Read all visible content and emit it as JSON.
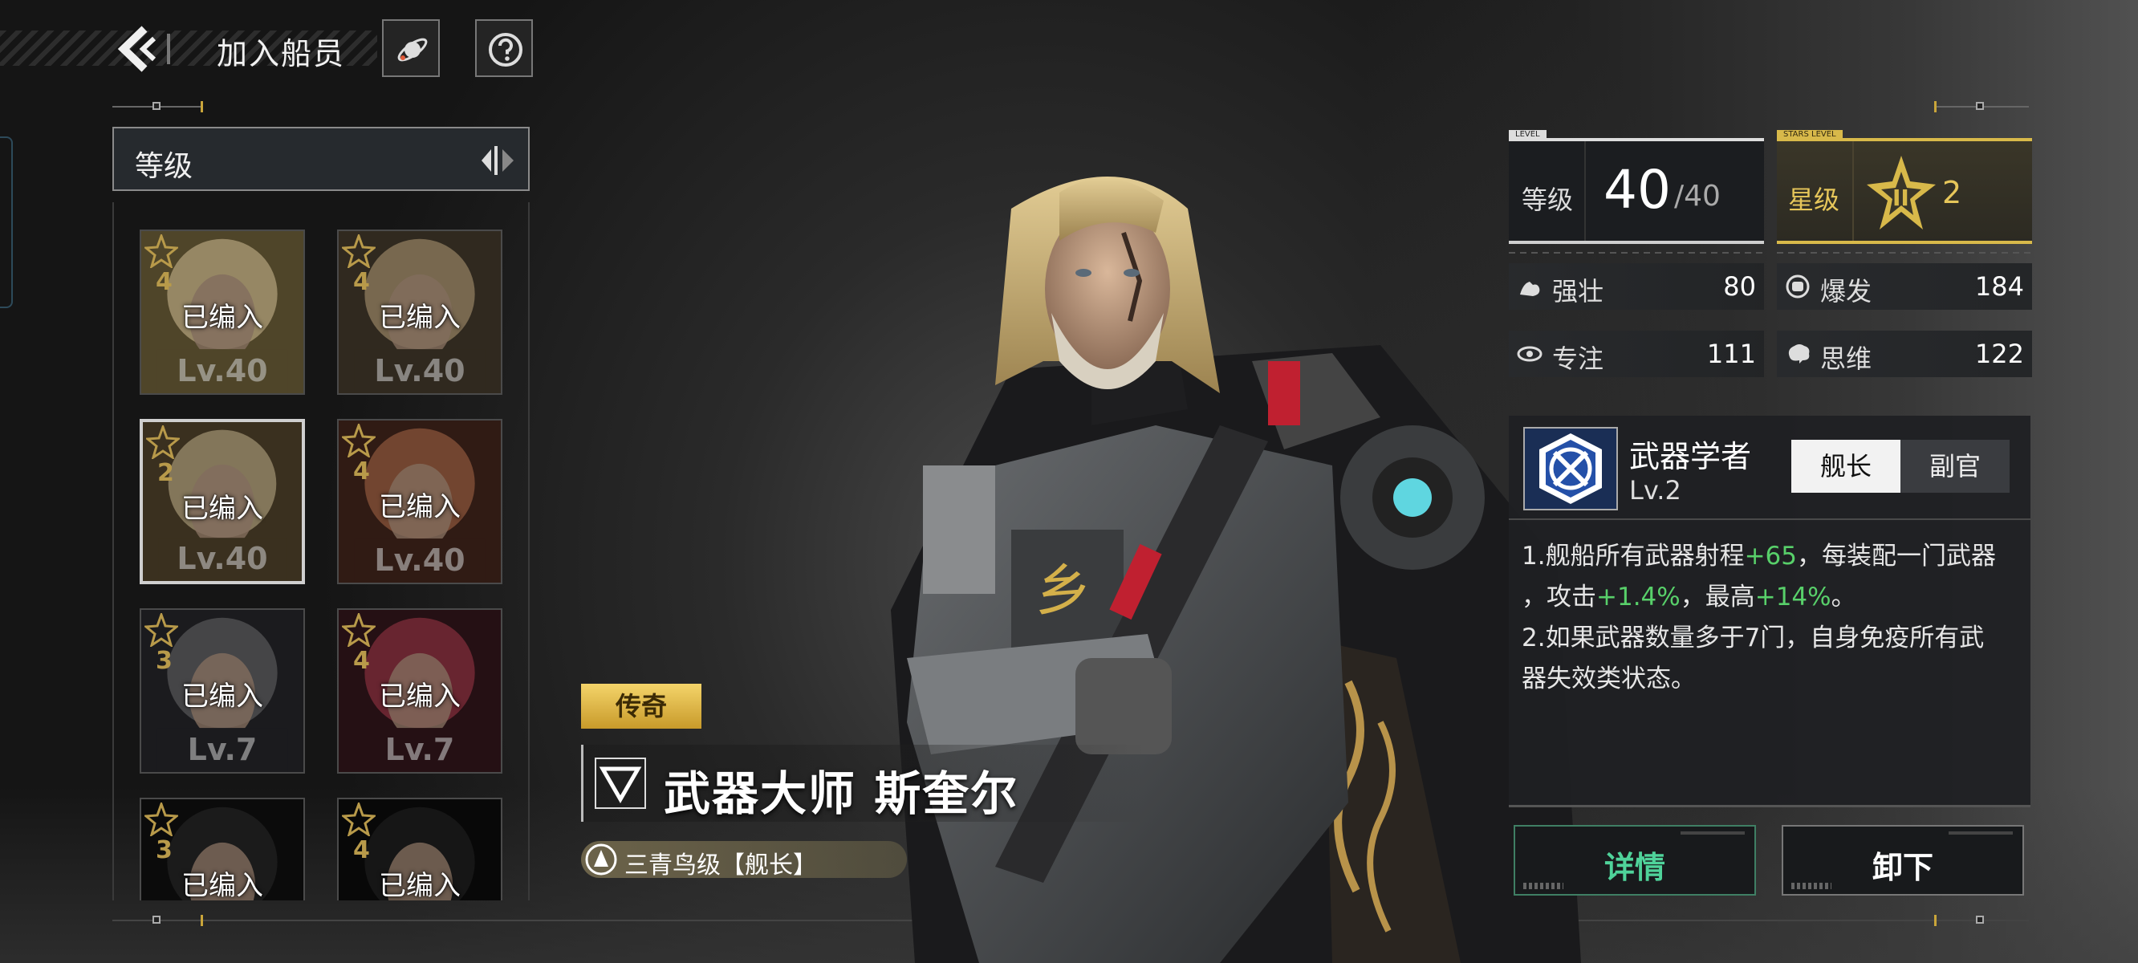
{
  "header": {
    "title": "加入船员"
  },
  "sort": {
    "label": "等级"
  },
  "crew_cards": [
    {
      "stars": "4",
      "status": "已编入",
      "level": "Lv.40",
      "selected": false
    },
    {
      "stars": "4",
      "status": "已编入",
      "level": "Lv.40",
      "selected": false
    },
    {
      "stars": "2",
      "status": "已编入",
      "level": "Lv.40",
      "selected": true
    },
    {
      "stars": "4",
      "status": "已编入",
      "level": "Lv.40",
      "selected": false
    },
    {
      "stars": "3",
      "status": "已编入",
      "level": "Lv.7",
      "selected": false
    },
    {
      "stars": "4",
      "status": "已编入",
      "level": "Lv.7",
      "selected": false
    },
    {
      "stars": "3",
      "status": "已编入",
      "level": "",
      "selected": false
    },
    {
      "stars": "4",
      "status": "已编入",
      "level": "",
      "selected": false
    }
  ],
  "character": {
    "rarity": "传奇",
    "name": "武器大师 斯奎尔",
    "ship": "三青鸟级【舰长】"
  },
  "level_box": {
    "tag": "LEVEL",
    "label": "等级",
    "value": "40",
    "max": "/40"
  },
  "star_box": {
    "tag": "STARS LEVEL",
    "label": "星级",
    "value": "2"
  },
  "stats": [
    {
      "name": "强壮",
      "value": "80",
      "icon": "muscle-icon"
    },
    {
      "name": "爆发",
      "value": "184",
      "icon": "fist-icon"
    },
    {
      "name": "专注",
      "value": "111",
      "icon": "eye-icon"
    },
    {
      "name": "思维",
      "value": "122",
      "icon": "brain-icon"
    }
  ],
  "skill": {
    "name": "武器学者",
    "level": "Lv.2",
    "tabs": [
      "舰长",
      "副官"
    ],
    "active_tab": "舰长",
    "desc": {
      "l1_a": "1.舰船所有武器射程",
      "l1_b": "+65",
      "l1_c": "，每装配一门武器",
      "l2_a": "，攻击",
      "l2_b": "+1.4%",
      "l2_c": "，最高",
      "l2_d": "+14%",
      "l2_e": "。",
      "l3": "2.如果武器数量多于7门，自身免疫所有武",
      "l4": "器失效类状态。"
    }
  },
  "actions": {
    "detail": "详情",
    "unload": "卸下"
  },
  "colors": {
    "gold": "#d8b94a",
    "green_text": "#58d06a",
    "detail_green": "#4fd39a"
  }
}
